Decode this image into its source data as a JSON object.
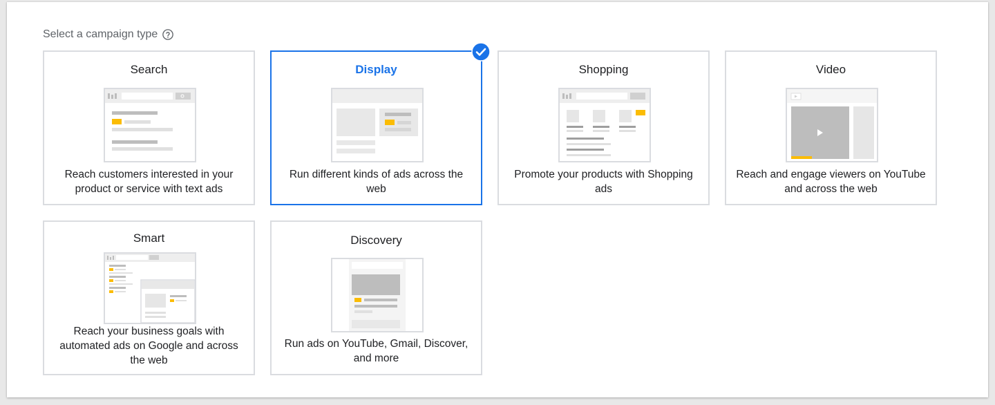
{
  "heading": {
    "label": "Select a campaign type",
    "help_icon": "help-circle-icon"
  },
  "colors": {
    "accent": "#1a73e8",
    "border": "#dadce0",
    "highlight": "#fbbc04",
    "illustration_gray": "#bdbdbd"
  },
  "campaign_types": [
    {
      "title": "Search",
      "description": "Reach customers interested in your product or service with text ads",
      "selected": false
    },
    {
      "title": "Display",
      "description": "Run different kinds of ads across the web",
      "selected": true
    },
    {
      "title": "Shopping",
      "description": "Promote your products with Shopping ads",
      "selected": false
    },
    {
      "title": "Video",
      "description": "Reach and engage viewers on YouTube and across the web",
      "selected": false
    },
    {
      "title": "Smart",
      "description": "Reach your business goals with automated ads on Google and across the web",
      "selected": false
    },
    {
      "title": "Discovery",
      "description": "Run ads on YouTube, Gmail, Discover, and more",
      "selected": false
    }
  ]
}
